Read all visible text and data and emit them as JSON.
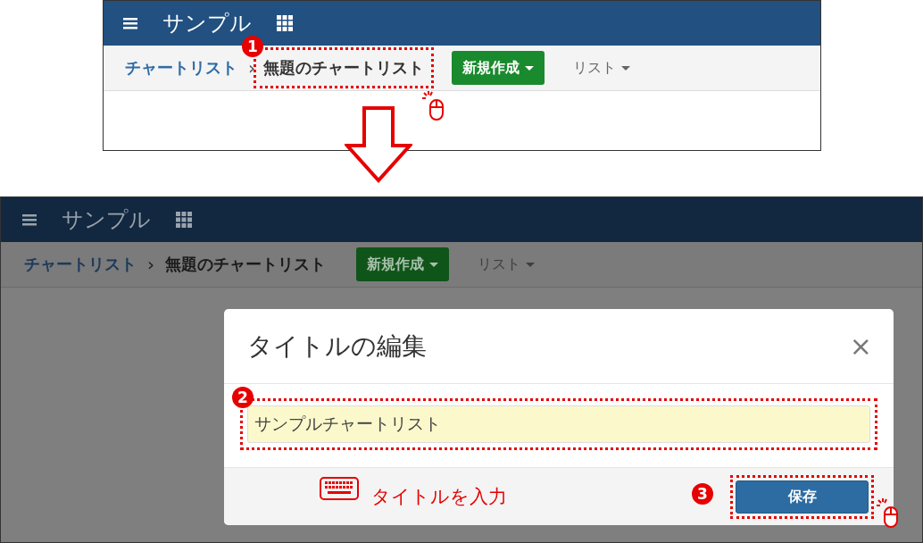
{
  "screens": [
    {
      "dimmed": false,
      "navbar": {
        "title": "サンプル"
      },
      "breadcrumbs": [
        {
          "label": "チャートリスト",
          "current": false
        },
        {
          "label": "無題のチャートリスト",
          "current": true
        }
      ],
      "separator": "›",
      "step": "1",
      "new_button": "新規作成",
      "list_menu": "リスト"
    },
    {
      "dimmed": true,
      "navbar": {
        "title": "サンプル"
      },
      "breadcrumbs": [
        {
          "label": "チャートリスト",
          "current": false
        },
        {
          "label": "無題のチャートリスト",
          "current": true
        }
      ],
      "separator": "›",
      "new_button": "新規作成",
      "list_menu": "リスト",
      "dialog": {
        "title": "タイトルの編集",
        "close": "×",
        "input_value": "サンプルチャートリスト",
        "input_step": "2",
        "hint": "タイトルを入力",
        "save_button": "保存",
        "save_step": "3"
      }
    }
  ]
}
